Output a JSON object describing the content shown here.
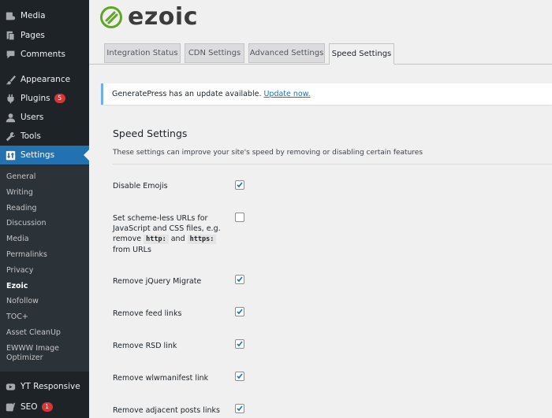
{
  "sidebar": {
    "items": [
      {
        "label": "Media",
        "icon": "media-icon"
      },
      {
        "label": "Pages",
        "icon": "pages-icon"
      },
      {
        "label": "Comments",
        "icon": "comments-icon"
      },
      {
        "label": "Appearance",
        "icon": "appearance-icon"
      },
      {
        "label": "Plugins",
        "icon": "plugins-icon",
        "badge": "5"
      },
      {
        "label": "Users",
        "icon": "users-icon"
      },
      {
        "label": "Tools",
        "icon": "tools-icon"
      },
      {
        "label": "Settings",
        "icon": "settings-icon"
      },
      {
        "label": "YT Responsive",
        "icon": "youtube-icon"
      },
      {
        "label": "SEO",
        "icon": "yoast-icon",
        "badge": "1"
      }
    ],
    "submenu": [
      "General",
      "Writing",
      "Reading",
      "Discussion",
      "Media",
      "Permalinks",
      "Privacy",
      "Ezoic",
      "Nofollow",
      "TOC+",
      "Asset CleanUp",
      "EWWW Image Optimizer"
    ]
  },
  "logo": {
    "text": "ezoic",
    "color": "#5fa624"
  },
  "tabs": [
    "Integration Status",
    "CDN Settings",
    "Advanced Settings",
    "Speed Settings"
  ],
  "notice": {
    "text": "GeneratePress has an update available.",
    "link": "Update now."
  },
  "section": {
    "title": "Speed Settings",
    "description": "These settings can improve your site's speed by removing or disabling certain features"
  },
  "settings": [
    {
      "label": "Disable Emojis",
      "checked": true
    },
    {
      "label_parts": [
        "Set scheme-less URLs for JavaScript and CSS files, e.g. remove",
        "http:",
        "and",
        "https:",
        "from URLs"
      ],
      "checked": false
    },
    {
      "label": "Remove jQuery Migrate",
      "checked": true
    },
    {
      "label": "Remove feed links",
      "checked": true
    },
    {
      "label": "Remove RSD link",
      "checked": true
    },
    {
      "label": "Remove wlwmanifest link",
      "checked": true
    },
    {
      "label": "Remove adjacent posts links",
      "checked": true
    }
  ],
  "colors": {
    "accent": "#2271b1",
    "sidebar": "#1d2327",
    "badge": "#d63638"
  }
}
